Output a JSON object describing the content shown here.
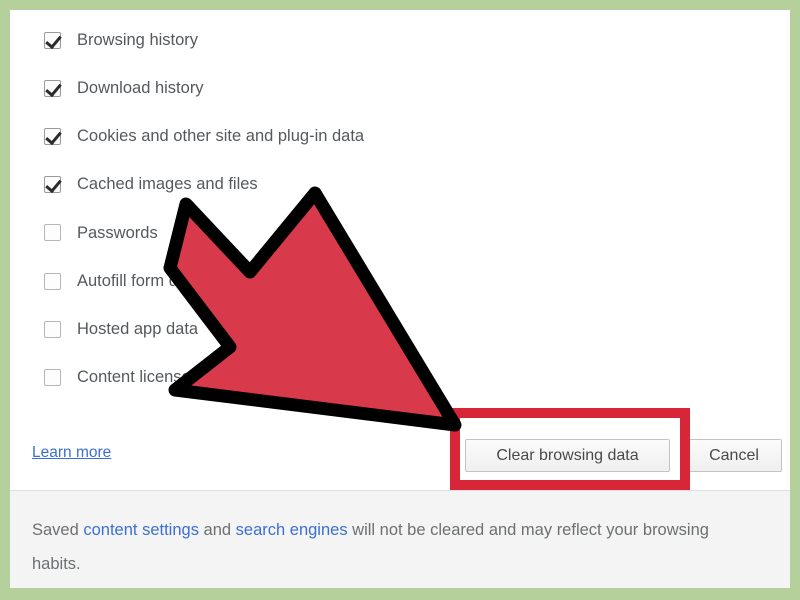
{
  "frame": {
    "border_color": "#b5d09a"
  },
  "dialog": {
    "background": "#ffffff",
    "checkbox_items": [
      {
        "label": "Browsing history",
        "checked": true
      },
      {
        "label": "Download history",
        "checked": true
      },
      {
        "label": "Cookies and other site and plug-in data",
        "checked": true
      },
      {
        "label": "Cached images and files",
        "checked": true
      },
      {
        "label": "Passwords",
        "checked": false
      },
      {
        "label": "Autofill form data",
        "checked": false
      },
      {
        "label": "Hosted app data",
        "checked": false
      },
      {
        "label": "Content licenses",
        "checked": false
      }
    ],
    "learn_more_label": "Learn more",
    "buttons": {
      "clear_label": "Clear browsing data",
      "cancel_label": "Cancel"
    },
    "footer": {
      "part1": "Saved ",
      "link1": "content settings",
      "part2": " and ",
      "link2": "search engines",
      "part3": " will not be cleared and may reflect your browsing habits."
    }
  },
  "annotations": {
    "highlight_color": "#d72638",
    "arrow_fill": "#d93a4b",
    "arrow_outline": "#000000",
    "arrow_name": "pointer-arrow"
  }
}
